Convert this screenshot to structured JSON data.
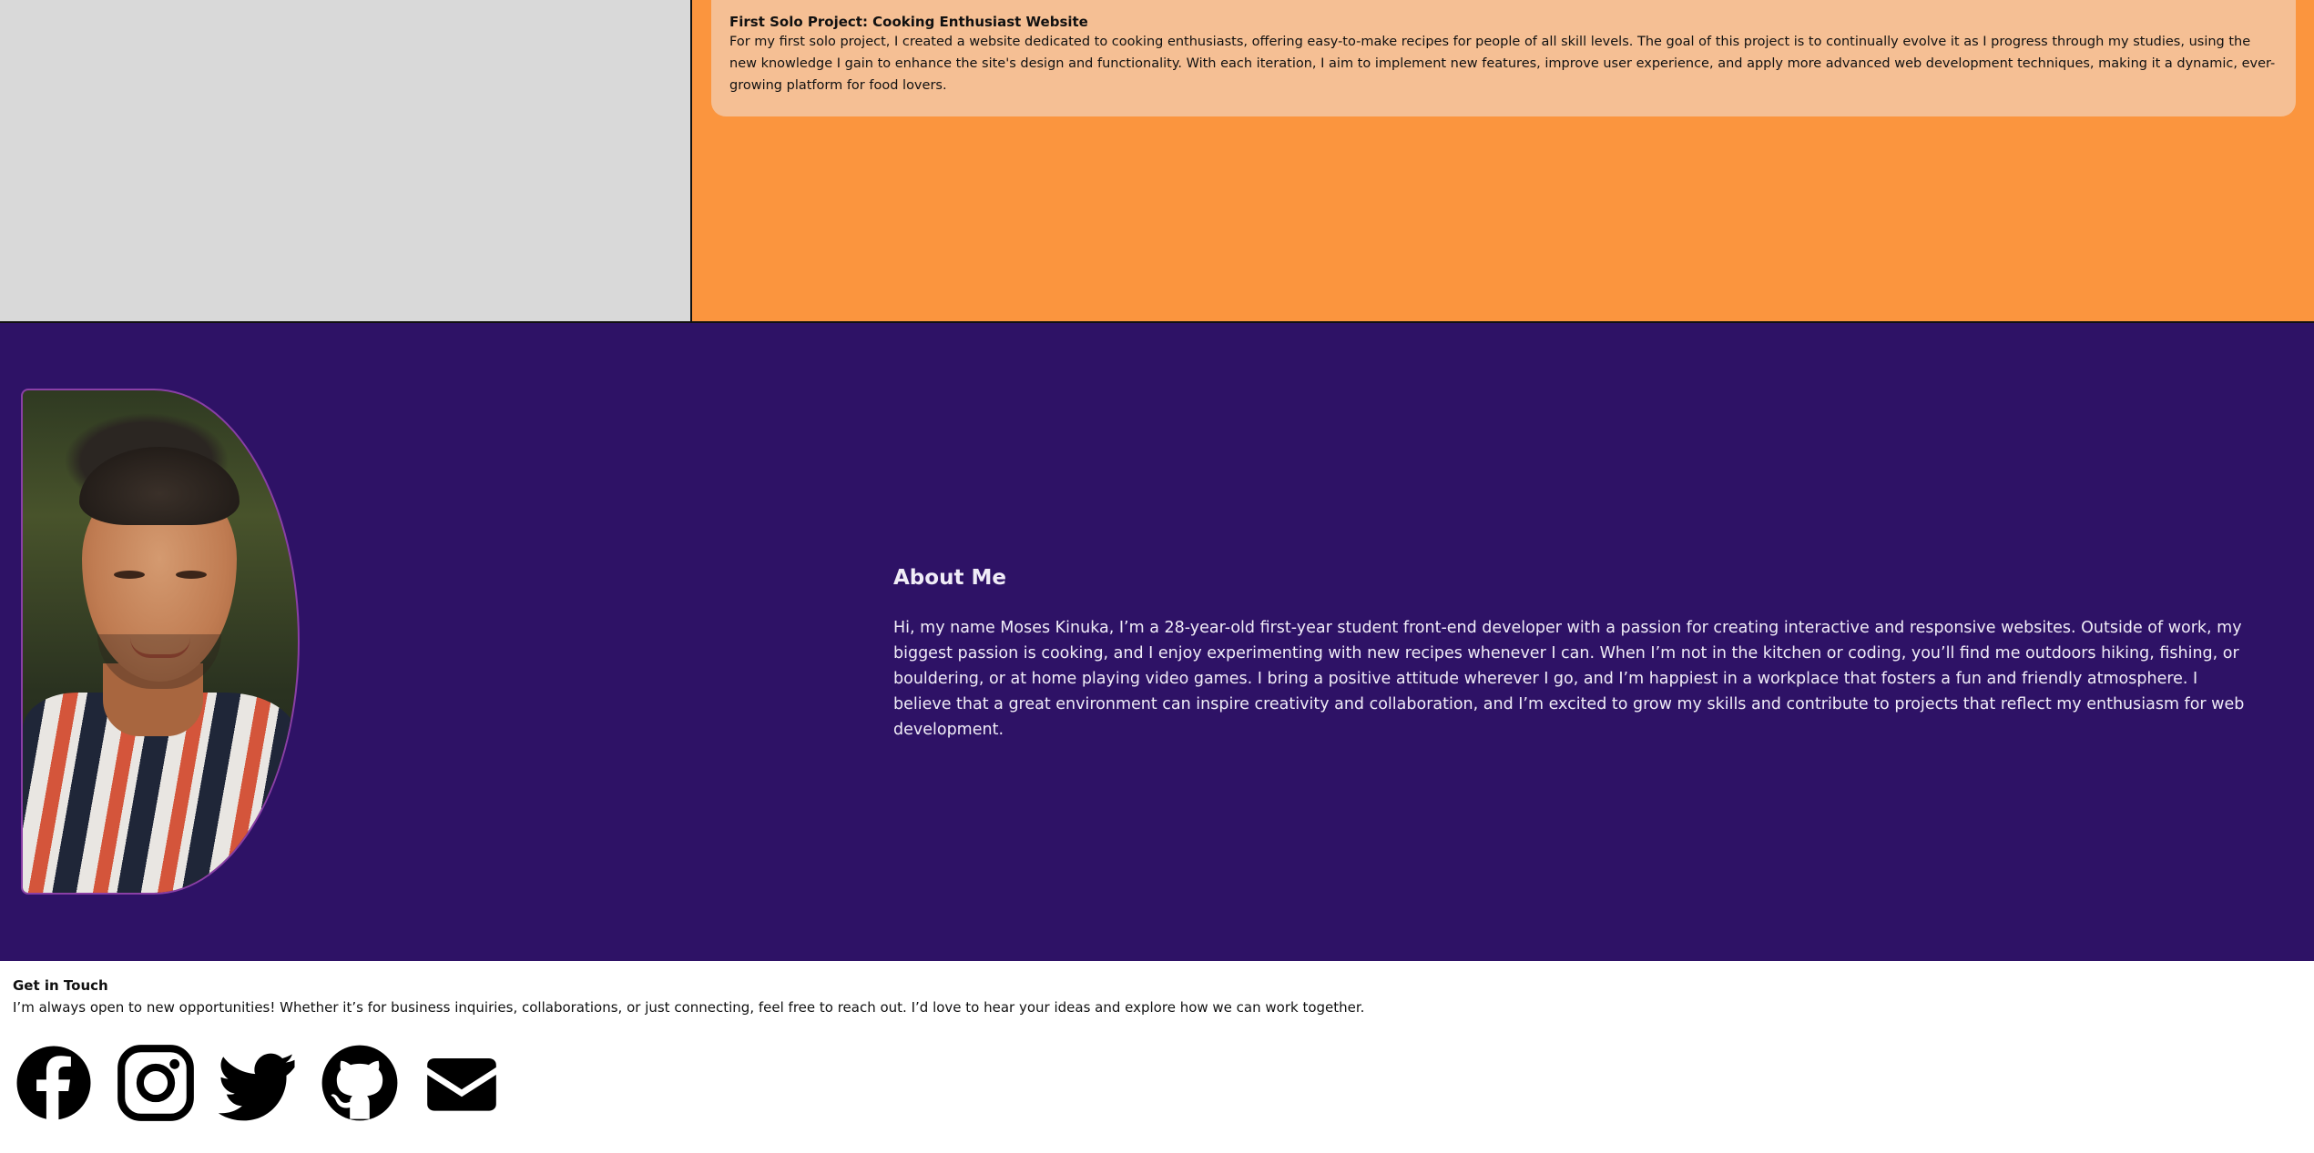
{
  "project": {
    "title": "First Solo Project: Cooking Enthusiast Website",
    "description": "For my first solo project, I created a website dedicated to cooking enthusiasts, offering easy-to-make recipes for people of all skill levels. The goal of this project is to continually evolve it as I progress through my studies, using the new knowledge I gain to enhance the site's design and functionality. With each iteration, I aim to implement new features, improve user experience, and apply more advanced web development techniques, making it a dynamic, ever-growing platform for food lovers."
  },
  "about": {
    "title": "About Me",
    "text": "Hi, my name Moses Kinuka, I’m a 28-year-old first-year student front-end developer with a passion for creating interactive and responsive websites. Outside of work, my biggest passion is cooking, and I enjoy experimenting with new recipes whenever I can. When I’m not in the kitchen or coding, you’ll find me outdoors hiking, fishing, or bouldering, or at home playing video games. I bring a positive attitude wherever I go, and I’m happiest in a workplace that fosters a fun and friendly atmosphere. I believe that a great environment can inspire creativity and collaboration, and I’m excited to grow my skills and contribute to projects that reflect my enthusiasm for web development."
  },
  "contact": {
    "title": "Get in Touch",
    "text": "I’m always open to new opportunities! Whether it’s for business inquiries, collaborations, or just connecting, feel free to reach out. I’d love to hear your ideas and explore how we can work together.",
    "social_icons": [
      "facebook-icon",
      "instagram-icon",
      "twitter-icon",
      "github-icon",
      "email-icon"
    ]
  },
  "colors": {
    "panel_gray": "#d9d9d9",
    "orange": "#fb953e",
    "card_peach": "#f5bf94",
    "about_purple": "#2e1266",
    "portrait_border": "#8a3fa6"
  }
}
